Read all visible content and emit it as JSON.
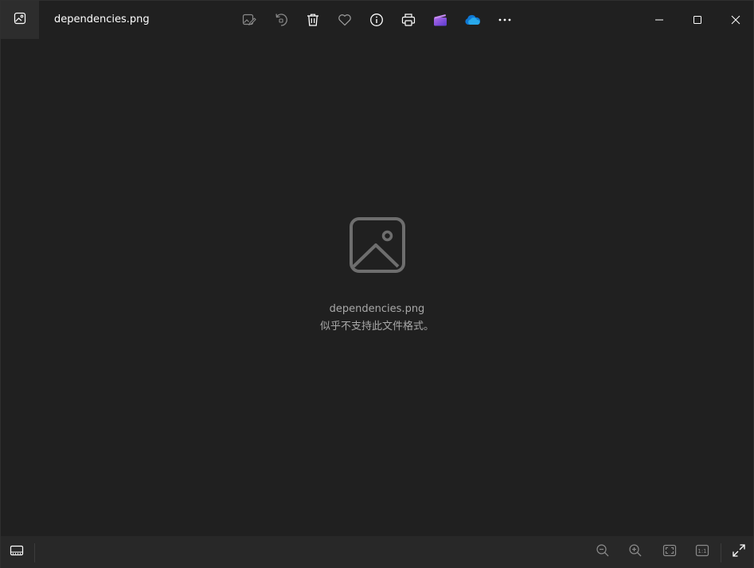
{
  "window": {
    "title": "dependencies.png"
  },
  "toolbar": {
    "buttons": [
      {
        "name": "edit-image-button",
        "icon": "edit-image-icon"
      },
      {
        "name": "rotate-button",
        "icon": "rotate-icon"
      },
      {
        "name": "delete-button",
        "icon": "trash-icon"
      },
      {
        "name": "favorite-button",
        "icon": "heart-icon"
      },
      {
        "name": "info-button",
        "icon": "info-icon"
      },
      {
        "name": "print-button",
        "icon": "printer-icon"
      },
      {
        "name": "clipchamp-button",
        "icon": "clipchamp-icon"
      },
      {
        "name": "onedrive-button",
        "icon": "onedrive-icon"
      },
      {
        "name": "more-button",
        "icon": "more-icon"
      }
    ]
  },
  "window_controls": {
    "minimize": "minimize-icon",
    "maximize": "maximize-icon",
    "close": "close-icon"
  },
  "content": {
    "filename": "dependencies.png",
    "message": "似乎不支持此文件格式。"
  },
  "bottombar": {
    "buttons": [
      {
        "name": "filmstrip-button",
        "icon": "filmstrip-icon"
      },
      {
        "name": "zoom-out-button",
        "icon": "zoom-out-icon"
      },
      {
        "name": "zoom-in-button",
        "icon": "zoom-in-icon"
      },
      {
        "name": "fit-to-window-button",
        "icon": "fit-icon"
      },
      {
        "name": "actual-size-button",
        "icon": "one-to-one-icon",
        "label": "1:1"
      },
      {
        "name": "fullscreen-button",
        "icon": "expand-icon"
      }
    ]
  },
  "colors": {
    "background": "#202020",
    "bottombar": "#282828",
    "icon": "#ffffff",
    "icon_disabled": "#8a8a8a",
    "text_secondary": "#a8a8a8",
    "onedrive": "#0f78d4",
    "clipchamp": "#7b4fd6"
  }
}
